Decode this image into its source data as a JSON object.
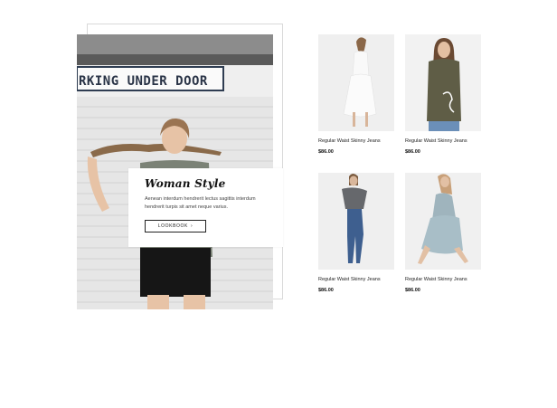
{
  "banner": {
    "sign_text": "RKING UNDER DOOR",
    "title": "Woman Style",
    "description": "Aenean interdum hendrerit lectus sagittis interdum hendrerit turpis sit amet neque varius.",
    "button_label": "LOOKBOOK",
    "button_arrow": "›"
  },
  "products": [
    {
      "name": "Regular Waist Skinny Jeans",
      "price": "$86.00",
      "image": "white-dress-model"
    },
    {
      "name": "Regular Waist Skinny Jeans",
      "price": "$86.00",
      "image": "olive-tshirt-model"
    },
    {
      "name": "Regular Waist Skinny Jeans",
      "price": "$86.00",
      "image": "jeans-offshoulder-model"
    },
    {
      "name": "Regular Waist Skinny Jeans",
      "price": "$86.00",
      "image": "blue-dress-model"
    }
  ],
  "colors": {
    "text_dark": "#111111",
    "image_bg": "#efefef"
  }
}
